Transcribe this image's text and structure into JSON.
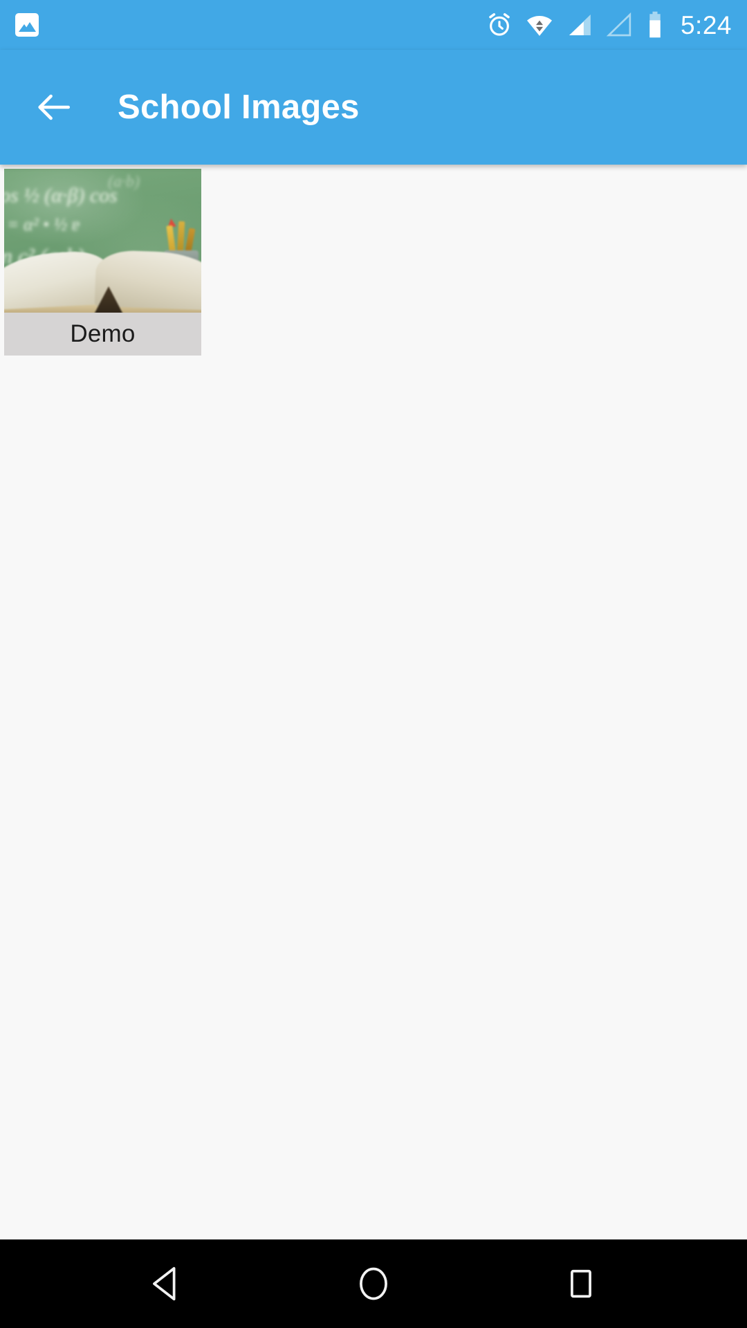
{
  "status_bar": {
    "background_color": "#41a8e6",
    "notification_icons": [
      {
        "name": "gallery-image-icon",
        "label": "Gallery"
      }
    ],
    "system_icons": [
      {
        "name": "alarm-clock-icon",
        "label": "Alarm set"
      },
      {
        "name": "wifi-data-transfer-icon",
        "label": "Wi-Fi"
      },
      {
        "name": "signal-sim1-icon",
        "label": "Signal SIM 1",
        "bars": "partial"
      },
      {
        "name": "signal-sim2-icon",
        "label": "Signal SIM 2",
        "bars": "none"
      },
      {
        "name": "battery-icon",
        "label": "Battery",
        "level_percent": 70
      }
    ],
    "clock": "5:24"
  },
  "app_bar": {
    "background_color": "#41a8e6",
    "back_button_label": "Navigate up",
    "title": "School Images"
  },
  "content": {
    "background_color": "#f8f8f8",
    "grid_items": [
      {
        "caption": "Demo",
        "image_alt": "Blurred classroom photo: green chalkboard with math formulas, open book and cup of pencils",
        "caption_background": "#d6d4d4",
        "chalkboard_text": {
          "line1": "os ½ (α·β) cos",
          "line2": "= α² • ½ ɐ",
          "line3": "n c²  (a•b)",
          "line4": "(a·b)"
        }
      }
    ]
  },
  "nav_bar": {
    "background_color": "#000000",
    "buttons": [
      {
        "name": "back",
        "label": "Back"
      },
      {
        "name": "home",
        "label": "Home"
      },
      {
        "name": "recents",
        "label": "Recent apps"
      }
    ]
  }
}
